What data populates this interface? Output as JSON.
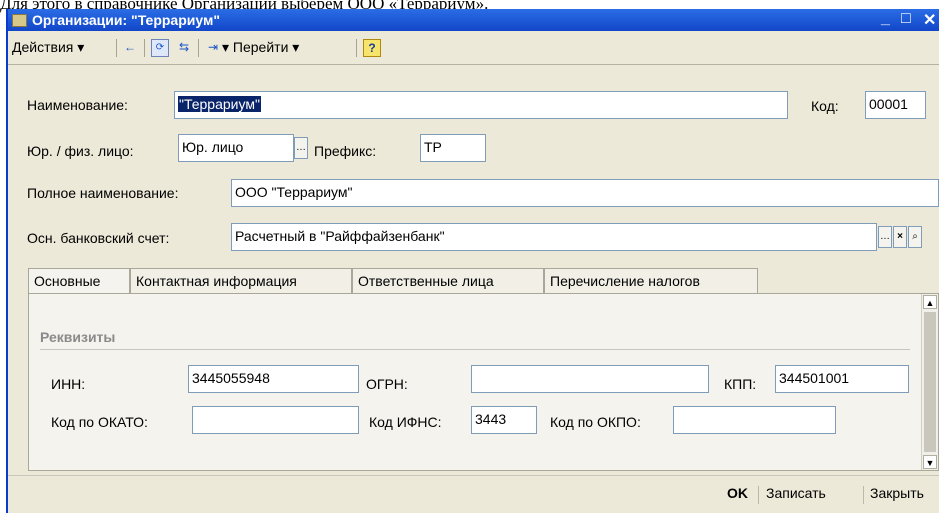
{
  "doc_text": "Для этого в справочнике Организации выберем ООО «Террариум».",
  "window": {
    "title": "Организации: \"Террариум\"",
    "minimize": "_",
    "maximize": "□",
    "close": "✕"
  },
  "toolbar": {
    "actions": "Действия ▾",
    "goto": "Перейти ▾",
    "help": "?"
  },
  "form": {
    "name_label": "Наименование:",
    "name_value": "\"Террариум\"",
    "code_label": "Код:",
    "code_value": "00001",
    "type_label": "Юр. / физ. лицо:",
    "type_value": "Юр. лицо",
    "prefix_label": "Префикс:",
    "prefix_value": "ТР",
    "fullname_label": "Полное наименование:",
    "fullname_value": "ООО \"Террариум\"",
    "account_label": "Осн. банковский счет:",
    "account_value": "Расчетный в \"Райффайзенбанк\""
  },
  "tabs": [
    {
      "label": "Основные"
    },
    {
      "label": "Контактная информация"
    },
    {
      "label": "Ответственные лица"
    },
    {
      "label": "Перечисление налогов"
    }
  ],
  "requisites": {
    "title": "Реквизиты",
    "inn_label": "ИНН:",
    "inn_value": "3445055948",
    "ogrn_label": "ОГРН:",
    "ogrn_value": "",
    "kpp_label": "КПП:",
    "kpp_value": "344501001",
    "okato_label": "Код по ОКАТО:",
    "okato_value": "",
    "ifns_label": "Код ИФНС:",
    "ifns_value": "3443",
    "okpo_label": "Код по ОКПО:",
    "okpo_value": ""
  },
  "buttons": {
    "ok": "OK",
    "save": "Записать",
    "close": "Закрыть"
  }
}
